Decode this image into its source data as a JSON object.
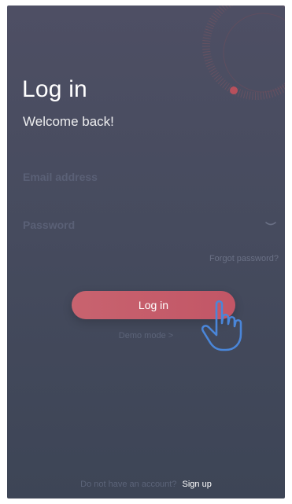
{
  "login": {
    "title": "Log in",
    "subtitle": "Welcome back!",
    "email_placeholder": "Email address",
    "password_placeholder": "Password",
    "password_toggle_icon": "chevron-down-icon",
    "forgot_label": "Forgot password?",
    "login_label": "Log in",
    "demo_label": "Demo mode",
    "demo_icon": "chevron-right-icon",
    "demo_chevron": ">"
  },
  "footer": {
    "prompt": "Do not have an account?",
    "signup_label": "Sign up"
  },
  "overlay": {
    "icon": "hand-pointer-icon"
  },
  "colors": {
    "background": "#464b5e",
    "accent": "#c8636f",
    "muted_text": "#5c6479",
    "hand_outline": "#4a86d9"
  }
}
